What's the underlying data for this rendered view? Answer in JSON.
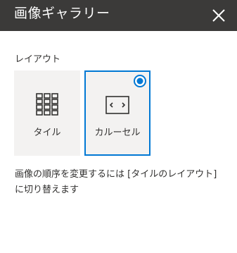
{
  "panel": {
    "title": "画像ギャラリー",
    "close_icon": "close-icon"
  },
  "layout": {
    "label": "レイアウト",
    "options": [
      {
        "label": "タイル",
        "icon": "grid-tile-icon",
        "selected": false
      },
      {
        "label": "カルーセル",
        "icon": "carousel-icon",
        "selected": true
      }
    ]
  },
  "description": "画像の順序を変更するには [タイルのレイアウト] に切り替えます",
  "colors": {
    "header_bg": "#3b3a39",
    "accent": "#0078d4",
    "card_bg": "#f3f2f1"
  }
}
